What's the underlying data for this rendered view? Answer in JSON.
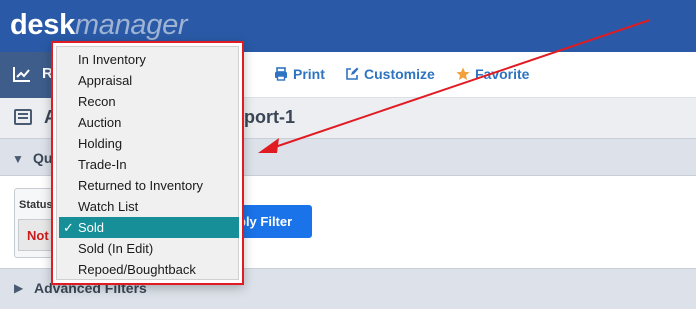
{
  "app": {
    "logo_part1": "desk",
    "logo_part2": "manager"
  },
  "toolbar": {
    "report_tab_label": "R",
    "print_label": "Print",
    "customize_label": "Customize",
    "favorite_label": "Favorite"
  },
  "page": {
    "title_left": "A",
    "title_right": "port-1"
  },
  "quick_filters": {
    "label": "Qu",
    "status_label": "Status",
    "status_value": "Not",
    "apply_label": "ply Filter"
  },
  "advanced_filters": {
    "label": "Advanced Filters"
  },
  "dropdown": {
    "check_mark": "✓",
    "options": [
      {
        "label": "In Inventory"
      },
      {
        "label": "Appraisal"
      },
      {
        "label": "Recon"
      },
      {
        "label": "Auction"
      },
      {
        "label": "Holding"
      },
      {
        "label": "Trade-In"
      },
      {
        "label": "Returned to Inventory"
      },
      {
        "label": "Watch List"
      },
      {
        "label": "Sold",
        "selected": true
      },
      {
        "label": "Sold (In Edit)"
      },
      {
        "label": "Repoed/Boughtback"
      }
    ]
  },
  "colors": {
    "header_bg": "#2a5aa7",
    "accent_blue": "#1a73e8",
    "selection_teal": "#178f99",
    "highlight_red": "#e11b22",
    "status_red": "#cc1b1b"
  }
}
